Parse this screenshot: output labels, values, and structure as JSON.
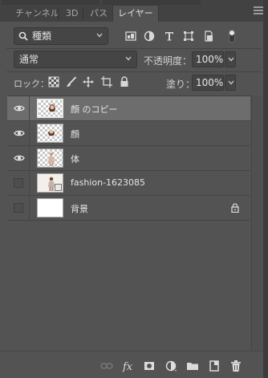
{
  "tabs": [
    {
      "label": "チャンネル",
      "active": false
    },
    {
      "label": "3D",
      "active": false
    },
    {
      "label": "パス",
      "active": false
    },
    {
      "label": "レイヤー",
      "active": true
    }
  ],
  "filter": {
    "kind_value": "種類",
    "icons": [
      "pixel-filter-icon",
      "adjustment-filter-icon",
      "type-filter-icon",
      "shape-filter-icon",
      "smart-object-filter-icon",
      "filter-toggle-icon"
    ]
  },
  "blend": {
    "mode": "通常",
    "opacity_label": "不透明度：",
    "opacity_value": "100%"
  },
  "lock": {
    "label": "ロック：",
    "icons": [
      "lock-transparent-pixels-icon",
      "lock-image-pixels-icon",
      "lock-position-icon",
      "lock-artboard-icon",
      "lock-all-icon"
    ],
    "fill_label": "塗り：",
    "fill_value": "100%"
  },
  "layers": [
    {
      "name": "顔 のコピー",
      "visible": true,
      "selected": true,
      "thumb": "transparent-figure",
      "locked": false
    },
    {
      "name": "顔",
      "visible": true,
      "selected": false,
      "thumb": "transparent-figure",
      "locked": false
    },
    {
      "name": "体",
      "visible": true,
      "selected": false,
      "thumb": "transparent-figure",
      "locked": false
    },
    {
      "name": "fashion-1623085",
      "visible": false,
      "selected": false,
      "thumb": "smart-object",
      "locked": false
    },
    {
      "name": "背景",
      "visible": false,
      "selected": false,
      "thumb": "white",
      "locked": true
    }
  ],
  "bottom_icons": [
    "link-layers-icon",
    "fx-icon",
    "add-mask-icon",
    "adjustment-layer-icon",
    "new-group-icon",
    "new-layer-icon",
    "delete-layer-icon"
  ],
  "colors": {
    "panel_bg": "#535353",
    "selected_row": "#6d6d6d",
    "text": "#e4e4e4"
  }
}
